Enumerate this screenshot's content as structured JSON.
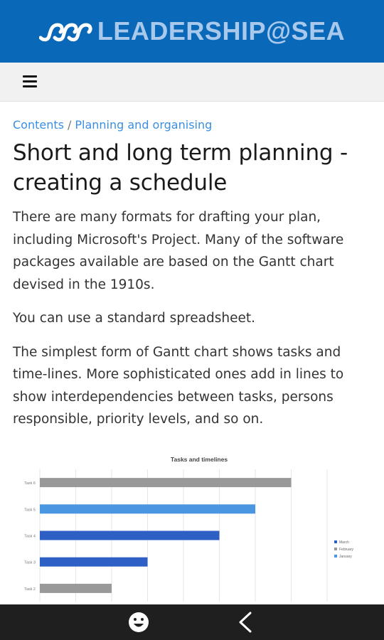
{
  "header": {
    "logo_text": "LEADERSHIP@SEA"
  },
  "toolbar": {
    "menu_icon": "hamburger-icon"
  },
  "breadcrumb": {
    "item1": "Contents",
    "separator": "/",
    "item2": "Planning and organising"
  },
  "article": {
    "title": "Short and long term planning - creating a schedule",
    "paragraphs": [
      "There are many formats for drafting your plan, including Microsoft's Project. Many of the software packages available are based on the Gantt chart devised in the 1910s.",
      "You can use a standard spreadsheet.",
      "The simplest form of Gantt chart shows tasks and time-lines. More sophisticated ones add in lines to show interdependencies between tasks, persons responsible, priority levels, and so on."
    ]
  },
  "chart_data": {
    "type": "bar",
    "title": "Tasks and timelines",
    "categories": [
      "Task 6",
      "Task 5",
      "Task 4",
      "Task 3",
      "Task 2"
    ],
    "series": [
      {
        "name": "March",
        "color": "#2e5fc5"
      },
      {
        "name": "February",
        "color": "#999999"
      },
      {
        "name": "January",
        "color": "#4a96e0"
      }
    ],
    "bars": [
      {
        "category": "Task 6",
        "series": "February",
        "value": 7
      },
      {
        "category": "Task 5",
        "series": "January",
        "value": 6
      },
      {
        "category": "Task 4",
        "series": "March",
        "value": 5
      },
      {
        "category": "Task 3",
        "series": "March",
        "value": 3
      },
      {
        "category": "Task 2",
        "series": "February",
        "value": 2
      }
    ],
    "xlim": [
      0,
      8
    ],
    "grid": true,
    "legend_position": "right"
  },
  "navbar": {
    "emoji_icon": "emoji-icon",
    "back_icon": "back-chevron-icon"
  }
}
